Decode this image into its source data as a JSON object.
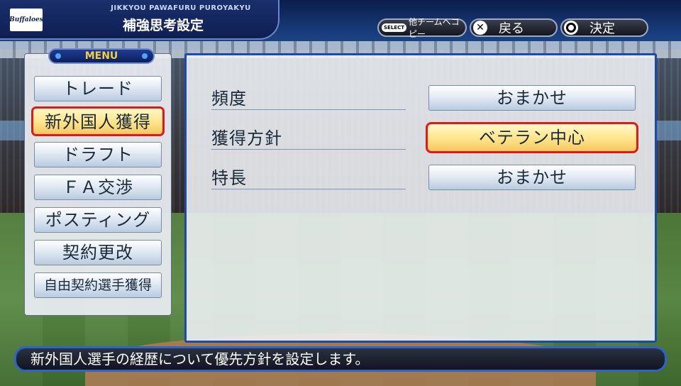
{
  "header": {
    "subtitle": "JIKKYOU PAWAFURU PUROYAKYU",
    "title": "補強思考設定",
    "logo_text": "Buffaloes"
  },
  "buttons": {
    "select_badge": "SELECT",
    "copy_label": "他チームへコピー",
    "back_glyph": "✕",
    "back_label": "戻る",
    "ok_label": "決定"
  },
  "menu": {
    "header": "MENU",
    "items": [
      {
        "label": "トレード"
      },
      {
        "label": "新外国人獲得",
        "selected": true
      },
      {
        "label": "ドラフト"
      },
      {
        "label": "ＦＡ交渉"
      },
      {
        "label": "ポスティング"
      },
      {
        "label": "契約更改"
      },
      {
        "label": "自由契約選手獲得"
      }
    ]
  },
  "settings": {
    "rows": [
      {
        "label": "頻度",
        "value": "おまかせ"
      },
      {
        "label": "獲得方針",
        "value": "ベテラン中心",
        "selected": true
      },
      {
        "label": "特長",
        "value": "おまかせ"
      }
    ]
  },
  "description": "新外国人選手の経歴について優先方針を設定します。",
  "colors": {
    "accent_blue": "#1d4aa8",
    "selection_red": "#e01a1a",
    "menu_header_text": "#f4d03c",
    "selected_fill": "#ffe48a"
  }
}
